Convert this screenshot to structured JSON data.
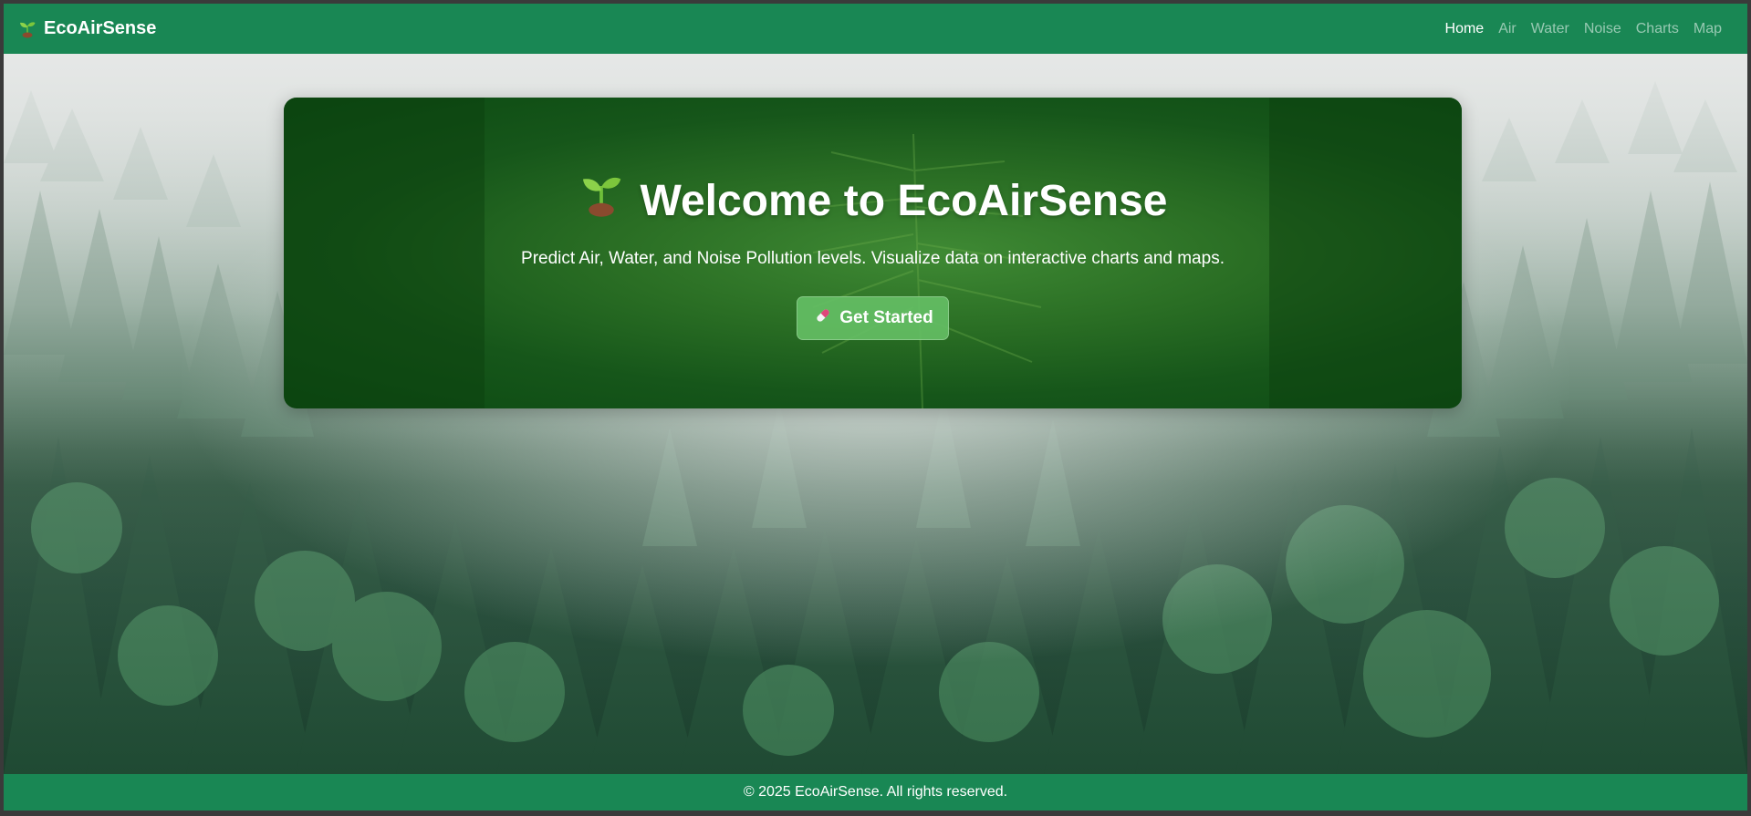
{
  "brand": {
    "name": "EcoAirSense",
    "icon": "seedling-icon"
  },
  "nav": {
    "items": [
      {
        "label": "Home",
        "active": true
      },
      {
        "label": "Air",
        "active": false
      },
      {
        "label": "Water",
        "active": false
      },
      {
        "label": "Noise",
        "active": false
      },
      {
        "label": "Charts",
        "active": false
      },
      {
        "label": "Map",
        "active": false
      }
    ]
  },
  "hero": {
    "title": "Welcome to EcoAirSense",
    "title_icon": "seedling-icon",
    "subtitle": "Predict Air, Water, and Noise Pollution levels. Visualize data on interactive charts and maps.",
    "cta_label": "Get Started",
    "cta_icon": "pill-icon"
  },
  "footer": {
    "text": "© 2025 EcoAirSense. All rights reserved."
  },
  "colors": {
    "nav_bg": "#198754",
    "footer_bg": "#198754",
    "hero_card_bg": "#1b5e20",
    "cta_bg": "#64be64"
  }
}
